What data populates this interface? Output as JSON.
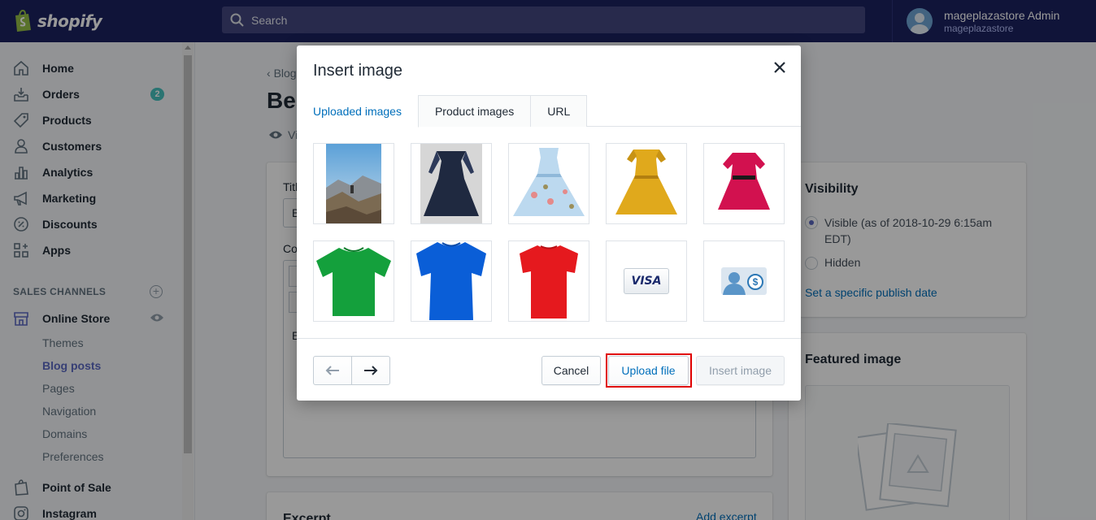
{
  "topbar": {
    "brand": "shopify",
    "search_placeholder": "Search",
    "user_name": "mageplazastore Admin",
    "user_store": "mageplazastore"
  },
  "sidebar": {
    "items": [
      {
        "label": "Home",
        "icon": "home-icon"
      },
      {
        "label": "Orders",
        "icon": "orders-icon",
        "badge": "2"
      },
      {
        "label": "Products",
        "icon": "tag-icon"
      },
      {
        "label": "Customers",
        "icon": "customer-icon"
      },
      {
        "label": "Analytics",
        "icon": "bar-chart-icon"
      },
      {
        "label": "Marketing",
        "icon": "megaphone-icon"
      },
      {
        "label": "Discounts",
        "icon": "discount-icon"
      },
      {
        "label": "Apps",
        "icon": "apps-icon"
      }
    ],
    "sales_channels_title": "SALES CHANNELS",
    "online_store": "Online Store",
    "sub_items": [
      "Themes",
      "Blog posts",
      "Pages",
      "Navigation",
      "Domains",
      "Preferences"
    ],
    "active_sub_item": "Blog posts",
    "point_of_sale": "Point of Sale",
    "instagram": "Instagram"
  },
  "page": {
    "breadcrumb": "Blog",
    "title": "Bes",
    "view_link": "Vi",
    "title_label": "Titl",
    "title_value": "B",
    "content_label": "Co",
    "content_text": "E",
    "visibility_title": "Visibility",
    "visible_label": "Visible (as of 2018-10-29 6:15am EDT)",
    "hidden_label": "Hidden",
    "publish_date_link": "Set a specific publish date",
    "featured_image_title": "Featured image",
    "excerpt_title": "Excerpt",
    "add_excerpt_link": "Add excerpt"
  },
  "modal": {
    "title": "Insert image",
    "tabs": [
      "Uploaded images",
      "Product images",
      "URL"
    ],
    "active_tab": "Uploaded images",
    "images": [
      {
        "name": "mountain-hiker-photo"
      },
      {
        "name": "navy-lace-dress"
      },
      {
        "name": "floral-light-blue-dress"
      },
      {
        "name": "mustard-yellow-dress"
      },
      {
        "name": "pink-dress"
      },
      {
        "name": "green-tshirt"
      },
      {
        "name": "blue-tshirt"
      },
      {
        "name": "red-tshirt"
      },
      {
        "name": "visa-card",
        "text": "VISA"
      },
      {
        "name": "payment-user-icon",
        "text": "$"
      }
    ],
    "buttons": {
      "cancel": "Cancel",
      "upload": "Upload file",
      "insert": "Insert image"
    }
  },
  "colors": {
    "topbar": "#1c2260",
    "accent": "#5c6ac4",
    "link": "#006fbb",
    "highlight": "#e00000"
  }
}
